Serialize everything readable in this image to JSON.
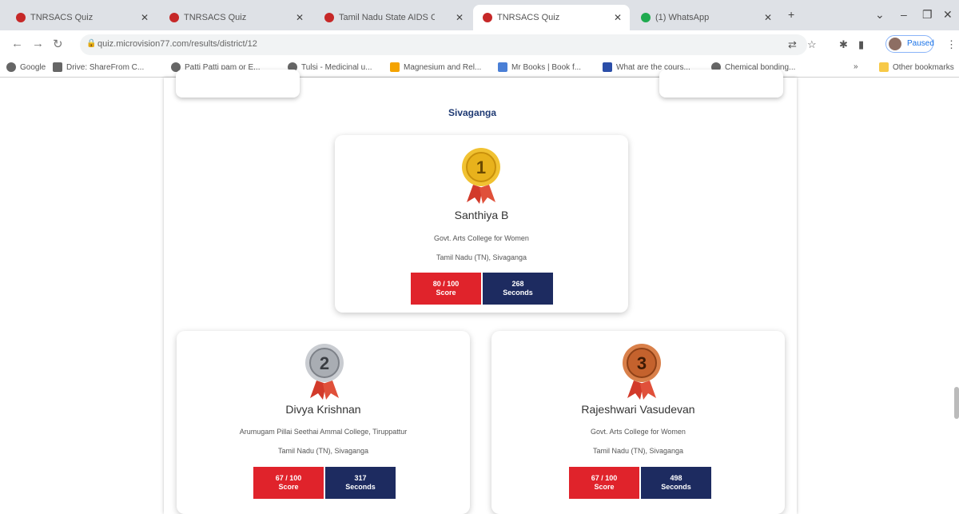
{
  "browser": {
    "tabs": [
      {
        "title": "TNRSACS Quiz",
        "favicon": "red-circle-icon"
      },
      {
        "title": "TNRSACS Quiz",
        "favicon": "red-circle-icon"
      },
      {
        "title": "Tamil Nadu State AIDS Contr",
        "favicon": "red-circle-icon"
      },
      {
        "title": "TNRSACS Quiz",
        "favicon": "red-circle-icon"
      },
      {
        "title": "(1) WhatsApp",
        "favicon": "whatsapp-icon"
      }
    ],
    "url": "quiz.microvision77.com/results/district/12",
    "profile_label": "Paused",
    "bookmarks": [
      {
        "label": "Google"
      },
      {
        "label": "Drive: ShareFrom C..."
      },
      {
        "label": "Patti Patti pam or E..."
      },
      {
        "label": "Tulsi - Medicinal u..."
      },
      {
        "label": "Magnesium and Rel..."
      },
      {
        "label": "Mr Books | Book f..."
      },
      {
        "label": "What are the cours..."
      },
      {
        "label": "Chemical bonding..."
      }
    ],
    "other_bookmarks": "Other bookmarks"
  },
  "district": "Sivaganga",
  "winners": [
    {
      "rank": "1",
      "name": "Santhiya B",
      "college": "Govt. Arts College for Women",
      "location": "Tamil Nadu (TN), Sivaganga",
      "score": "80 / 100",
      "score_label": "Score",
      "time": "268",
      "time_label": "Seconds",
      "medal": "gold"
    },
    {
      "rank": "2",
      "name": "Divya Krishnan",
      "college": "Arumugam Pillai Seethai Ammal College, Tiruppattur",
      "location": "Tamil Nadu (TN), Sivaganga",
      "score": "67 / 100",
      "score_label": "Score",
      "time": "317",
      "time_label": "Seconds",
      "medal": "silver"
    },
    {
      "rank": "3",
      "name": "Rajeshwari Vasudevan",
      "college": "Govt. Arts College for Women",
      "location": "Tamil Nadu (TN), Sivaganga",
      "score": "67 / 100",
      "score_label": "Score",
      "time": "498",
      "time_label": "Seconds",
      "medal": "bronze"
    }
  ],
  "colors": {
    "score": "#e0232b",
    "time": "#1d2b60",
    "gold": "#e8b21c",
    "silver": "#a9adb3",
    "bronze": "#c4622d"
  }
}
